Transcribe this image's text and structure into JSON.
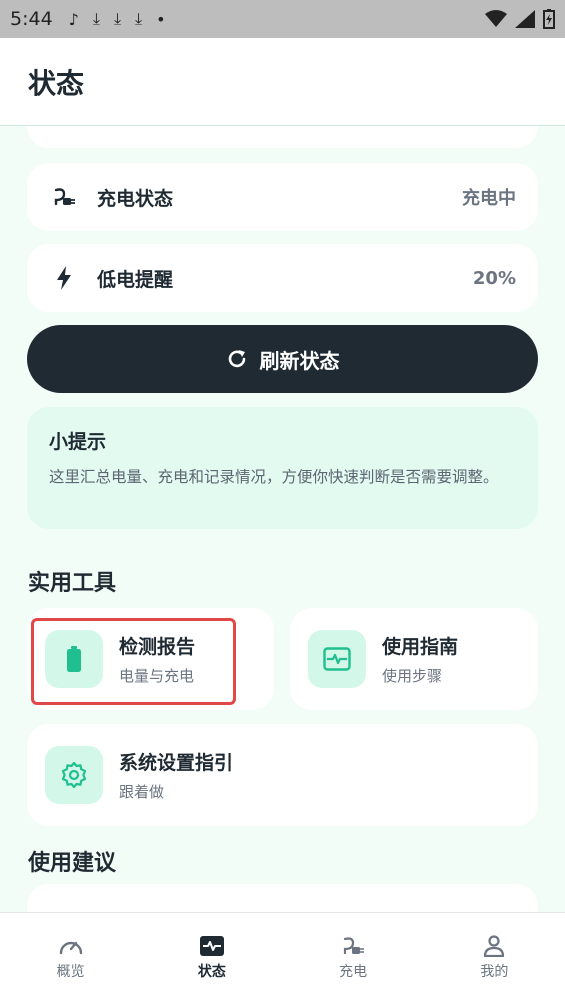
{
  "status_bar": {
    "time": "5:44"
  },
  "app_bar": {
    "title": "状态"
  },
  "rows": [
    {
      "label": "充电状态",
      "value": "充电中",
      "icon": "plug-icon"
    },
    {
      "label": "低电提醒",
      "value": "20%",
      "icon": "lightning-icon"
    }
  ],
  "refresh_button": {
    "label": "刷新状态",
    "icon": "refresh-icon"
  },
  "tip": {
    "title": "小提示",
    "body": "这里汇总电量、充电和记录情况，方便你快速判断是否需要调整。"
  },
  "tools_section": {
    "title": "实用工具",
    "items": [
      {
        "name": "检测报告",
        "sub": "电量与充电",
        "icon": "battery-icon"
      },
      {
        "name": "使用指南",
        "sub": "使用步骤",
        "icon": "pulse-icon"
      },
      {
        "name": "系统设置指引",
        "sub": "跟着做",
        "icon": "gear-icon"
      }
    ]
  },
  "advice_section": {
    "title": "使用建议"
  },
  "bottom_nav": {
    "active": 1,
    "items": [
      {
        "label": "概览",
        "icon": "speedometer-icon"
      },
      {
        "label": "状态",
        "icon": "pulse-icon"
      },
      {
        "label": "充电",
        "icon": "plug-icon"
      },
      {
        "label": "我的",
        "icon": "person-icon"
      }
    ]
  },
  "colors": {
    "accent": "#1fbf8f",
    "dark": "#1f2a33",
    "highlight": "#e04848"
  }
}
